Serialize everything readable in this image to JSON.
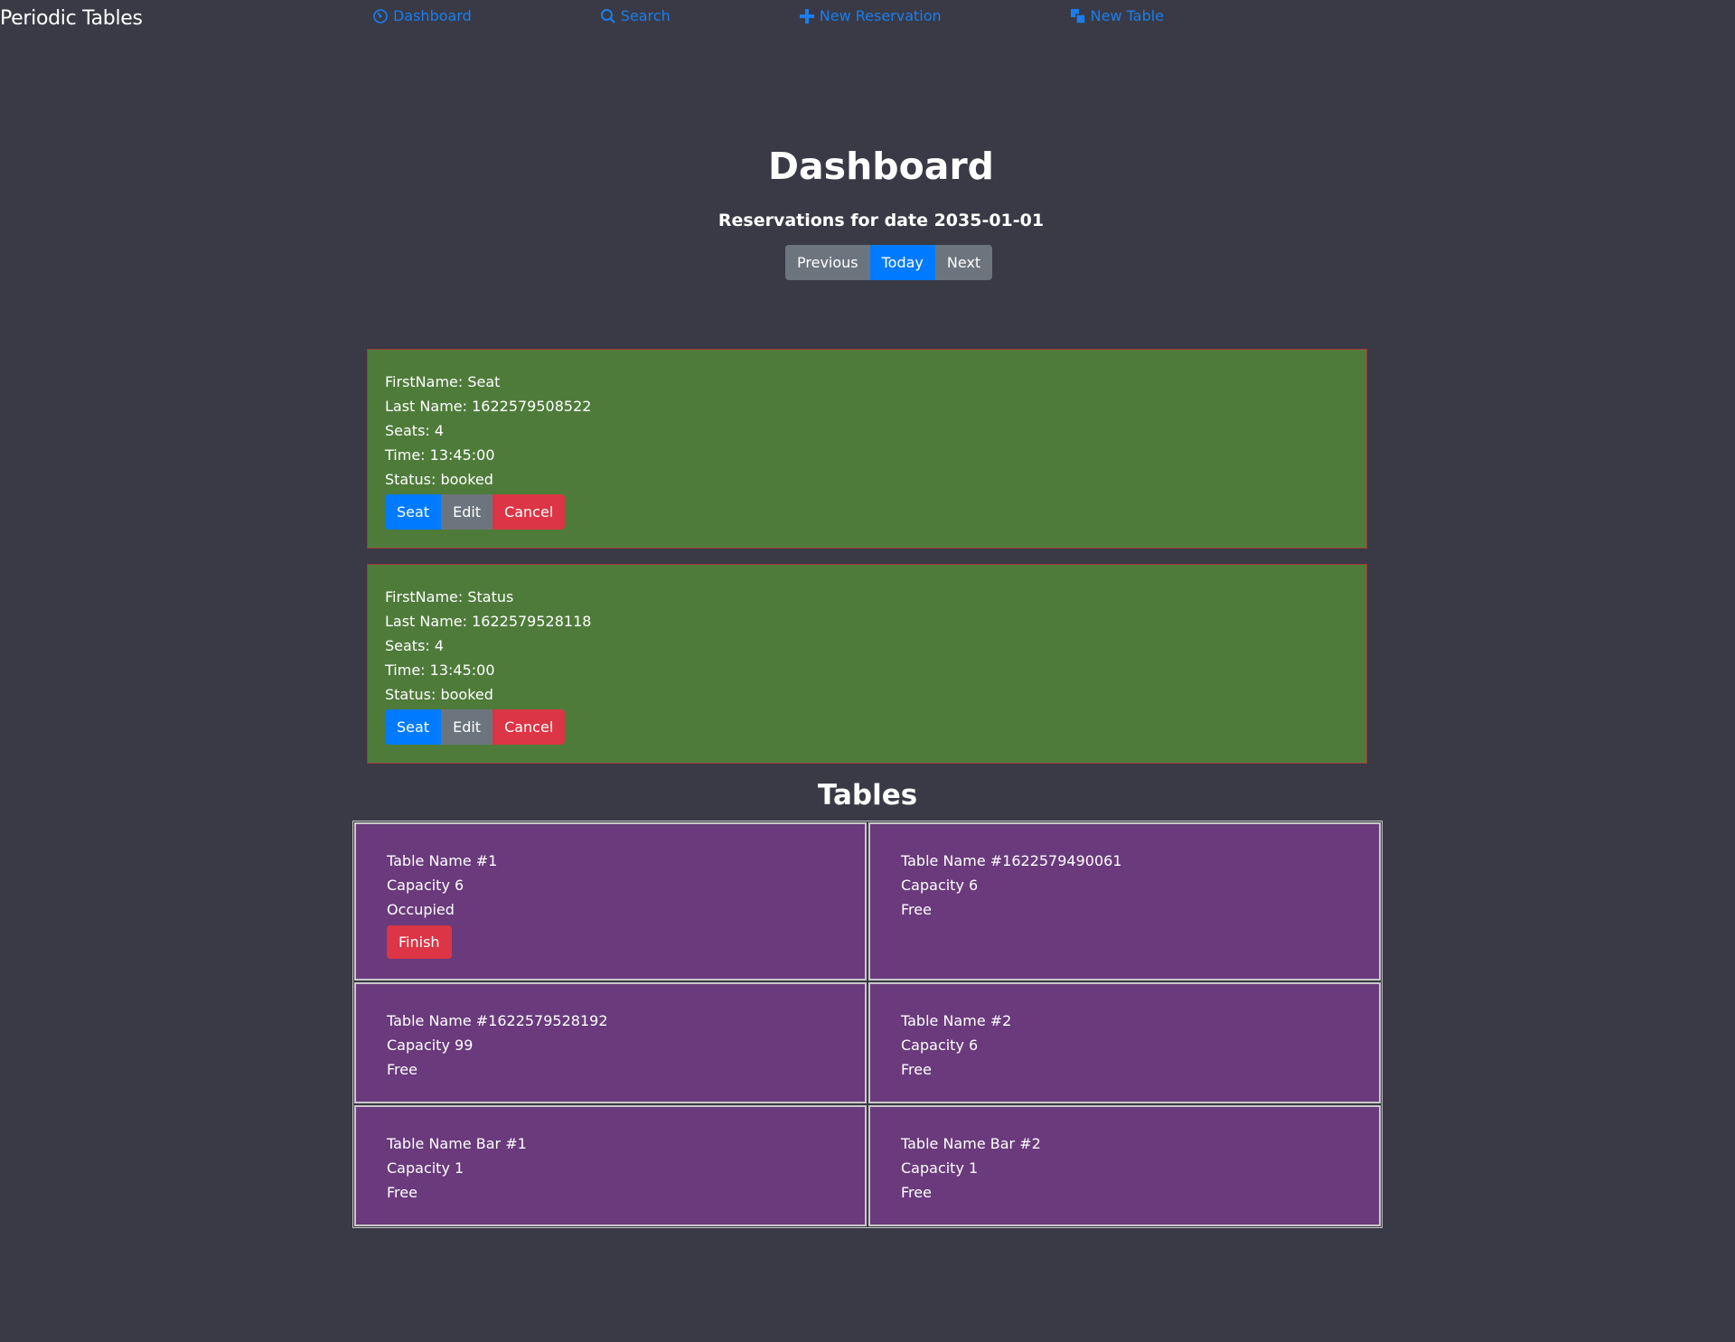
{
  "brand": "Periodic Tables",
  "nav": [
    {
      "label": "Dashboard",
      "icon": "dashboard-icon"
    },
    {
      "label": "Search",
      "icon": "search-icon"
    },
    {
      "label": "New Reservation",
      "icon": "plus-icon"
    },
    {
      "label": "New Table",
      "icon": "table-icon"
    }
  ],
  "page": {
    "title": "Dashboard",
    "subtitle": "Reservations for date 2035-01-01",
    "date_buttons": {
      "previous": "Previous",
      "today": "Today",
      "next": "Next"
    }
  },
  "reservations": [
    {
      "first_name": "FirstName: Seat",
      "last_name": "Last Name: 1622579508522",
      "seats": "Seats: 4",
      "time": "Time: 13:45:00",
      "status": "Status: booked",
      "seat_label": "Seat",
      "edit_label": "Edit",
      "cancel_label": "Cancel"
    },
    {
      "first_name": "FirstName: Status",
      "last_name": "Last Name: 1622579528118",
      "seats": "Seats: 4",
      "time": "Time: 13:45:00",
      "status": "Status: booked",
      "seat_label": "Seat",
      "edit_label": "Edit",
      "cancel_label": "Cancel"
    }
  ],
  "tables_heading": "Tables",
  "tables": [
    {
      "name": "Table Name #1",
      "capacity": "Capacity 6",
      "status": "Occupied",
      "finish_label": "Finish"
    },
    {
      "name": "Table Name #1622579490061",
      "capacity": "Capacity 6",
      "status": "Free"
    },
    {
      "name": "Table Name #1622579528192",
      "capacity": "Capacity 99",
      "status": "Free"
    },
    {
      "name": "Table Name #2",
      "capacity": "Capacity 6",
      "status": "Free"
    },
    {
      "name": "Table Name Bar #1",
      "capacity": "Capacity 1",
      "status": "Free"
    },
    {
      "name": "Table Name Bar #2",
      "capacity": "Capacity 1",
      "status": "Free"
    }
  ],
  "colors": {
    "background": "#393a45",
    "nav_link": "#1a7ef0",
    "reservation_card": "#4e7b3a",
    "table_card": "#6a3a7c",
    "btn_blue": "#007bff",
    "btn_gray": "#6c757d",
    "btn_red": "#dc3545"
  }
}
